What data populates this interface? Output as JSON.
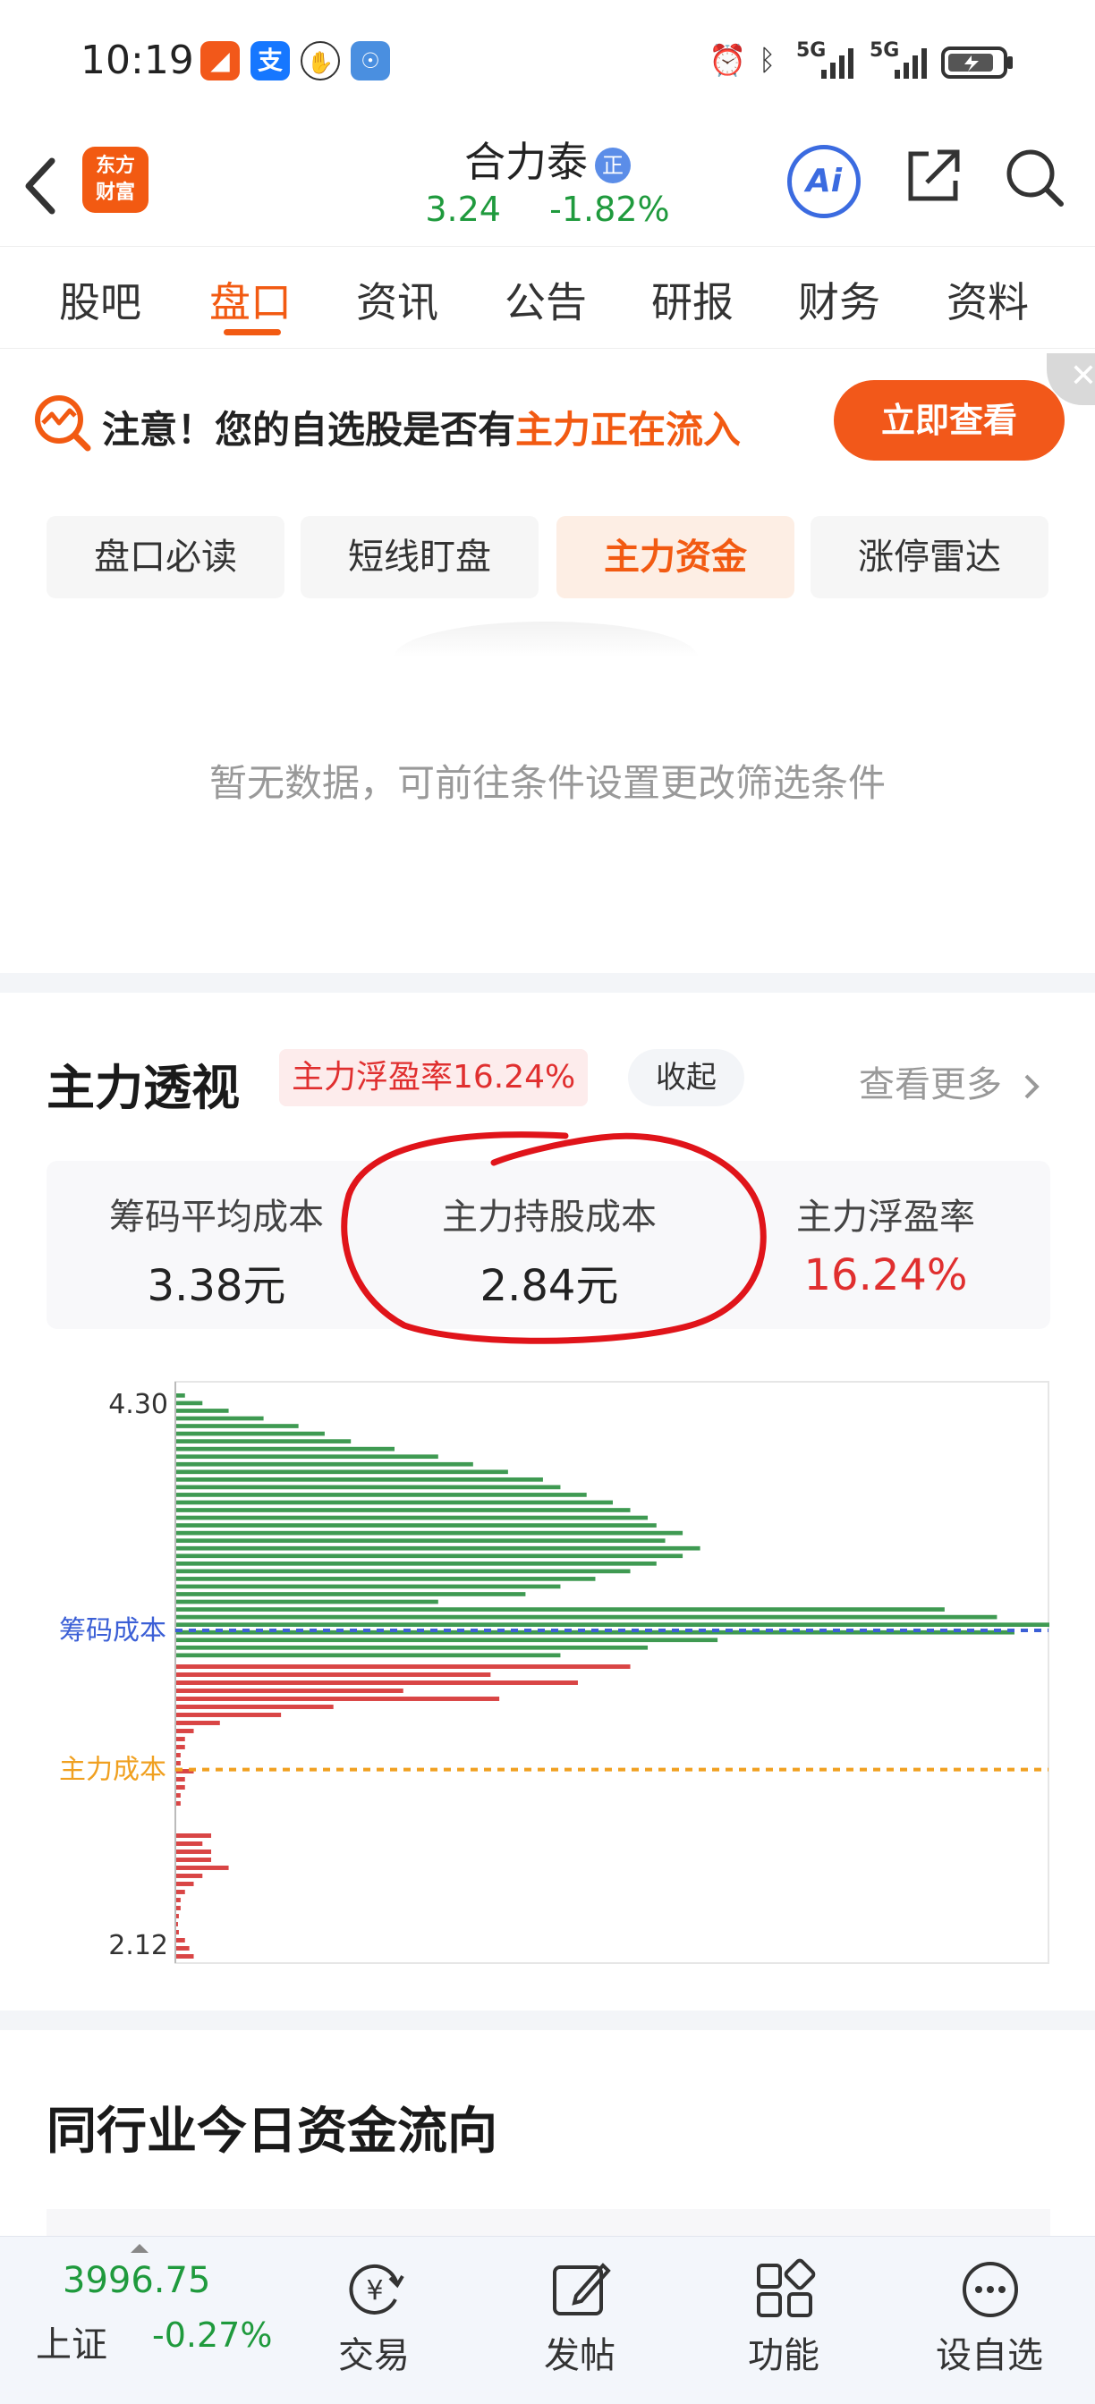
{
  "status_bar": {
    "time": "10:19",
    "network_1": "5G",
    "network_2": "5G"
  },
  "header": {
    "back_icon": "chevron-left-icon",
    "logo_text": "东方\n财富",
    "stock_name": "合力泰",
    "cert_badge": "正",
    "price": "3.24",
    "change": "-1.82%",
    "ai_label": "Ai",
    "price_color": "#1f9a3d",
    "accent": "#f25a12"
  },
  "tabs": [
    {
      "label": "股吧",
      "active": false
    },
    {
      "label": "盘口",
      "active": true
    },
    {
      "label": "资讯",
      "active": false
    },
    {
      "label": "公告",
      "active": false
    },
    {
      "label": "研报",
      "active": false
    },
    {
      "label": "财务",
      "active": false
    },
    {
      "label": "资料",
      "active": false
    }
  ],
  "banner": {
    "text_main": "注意！您的自选股是否有",
    "text_highlight": "主力正在流入",
    "button": "立即查看",
    "close": "✕"
  },
  "sub_tabs": [
    {
      "label": "盘口必读",
      "active": false
    },
    {
      "label": "短线盯盘",
      "active": false
    },
    {
      "label": "主力资金",
      "active": true
    },
    {
      "label": "涨停雷达",
      "active": false
    }
  ],
  "empty_message": "暂无数据，可前往条件设置更改筛选条件",
  "main_force": {
    "title": "主力透视",
    "profit_tag": "主力浮盈率16.24%",
    "collapse": "收起",
    "more": "查看更多",
    "stats": [
      {
        "label": "筹码平均成本",
        "value": "3.38元",
        "highlight": false
      },
      {
        "label": "主力持股成本",
        "value": "2.84元",
        "highlight": false
      },
      {
        "label": "主力浮盈率",
        "value": "16.24%",
        "highlight": true
      }
    ]
  },
  "chart_data": {
    "type": "bar",
    "orientation": "horizontal",
    "title": "",
    "y_top_label": "4.30",
    "y_bottom_label": "2.12",
    "ylim": [
      2.12,
      4.3
    ],
    "reference_lines": [
      {
        "label": "筹码成本",
        "value": 3.38,
        "color": "#3b5fd6"
      },
      {
        "label": "主力成本",
        "value": 2.84,
        "color": "#f0a020"
      }
    ],
    "series": [
      {
        "color": "#3f9a52",
        "values": [
          1,
          3,
          6,
          10,
          14,
          17,
          20,
          25,
          30,
          34,
          38,
          42,
          44,
          47,
          50,
          52,
          54,
          55,
          58,
          56,
          60,
          58,
          55,
          52,
          48,
          44,
          40,
          30,
          88,
          94,
          100,
          96,
          62,
          54,
          44
        ]
      },
      {
        "color": "#d94545",
        "values": [
          52,
          36,
          46,
          26,
          37,
          18,
          12,
          5,
          2,
          1,
          1,
          0.5,
          0.5,
          2,
          1,
          1,
          0.5,
          0.5,
          0,
          0,
          0,
          4,
          3,
          4,
          4,
          6,
          3,
          2,
          1,
          0.5,
          0.5,
          0.3,
          0.2,
          0.3,
          1,
          1.5,
          2
        ]
      }
    ]
  },
  "peer_section_title": "同行业今日资金流向",
  "bottom_nav": {
    "index_value": "3996.75",
    "index_name": "上证",
    "index_change": "-0.27%",
    "items": [
      {
        "label": "交易",
        "icon": "yen-refresh-icon"
      },
      {
        "label": "发帖",
        "icon": "edit-icon"
      },
      {
        "label": "功能",
        "icon": "grid-icon"
      },
      {
        "label": "设自选",
        "icon": "more-circle-icon"
      }
    ]
  }
}
